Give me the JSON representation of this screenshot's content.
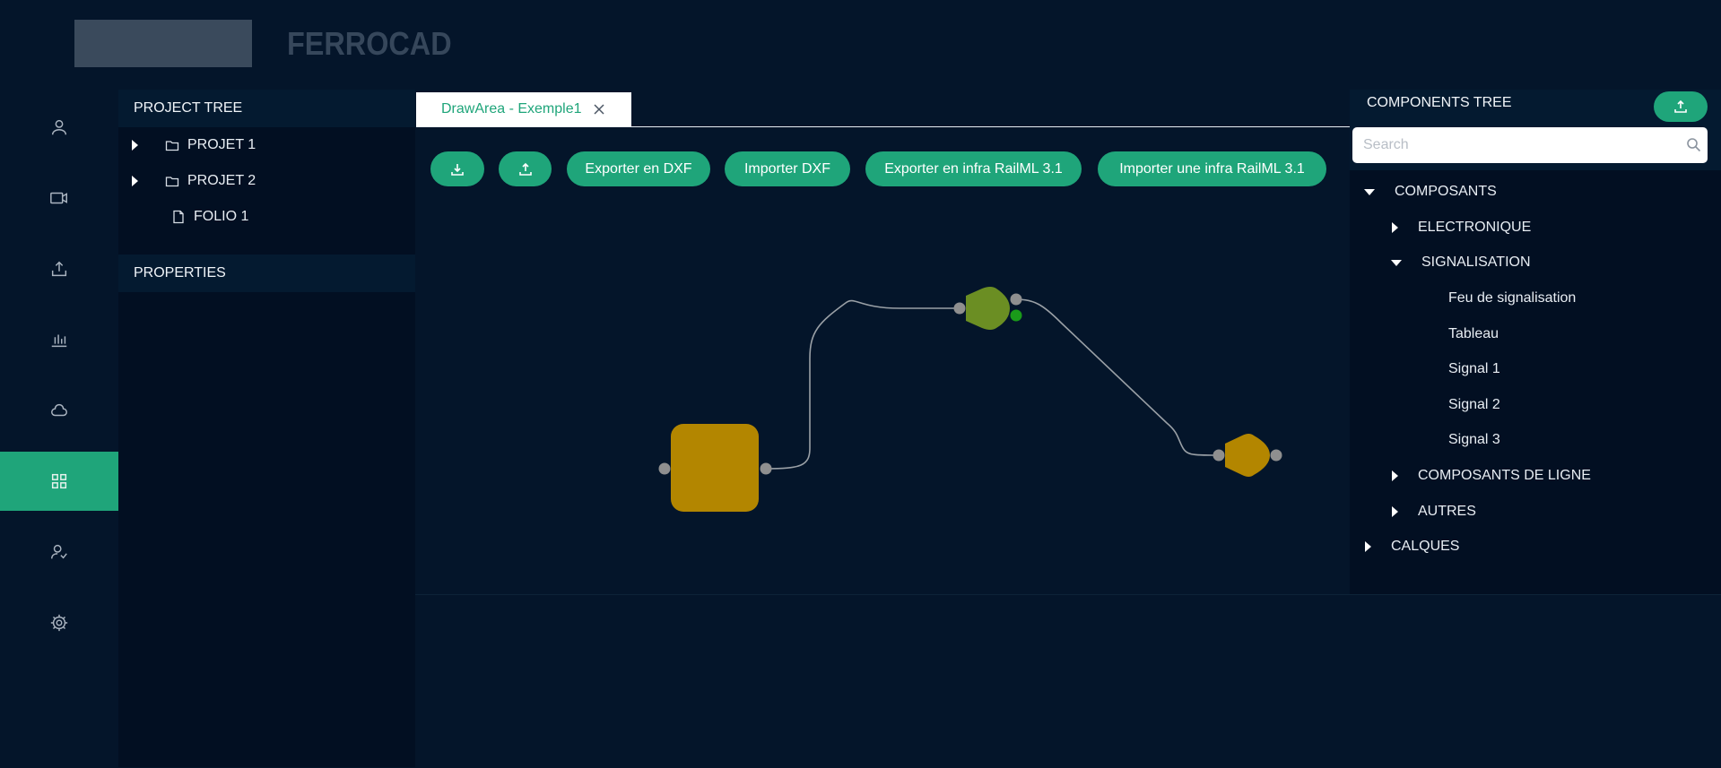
{
  "header": {
    "brand": "FERROCAD"
  },
  "nav": {
    "items": [
      {
        "icon": "user-icon",
        "active": false
      },
      {
        "icon": "video-icon",
        "active": false
      },
      {
        "icon": "upload-icon",
        "active": false
      },
      {
        "icon": "bar-chart-icon",
        "active": false
      },
      {
        "icon": "cloud-icon",
        "active": false
      },
      {
        "icon": "grid-icon",
        "active": true
      },
      {
        "icon": "users-icon",
        "active": false
      },
      {
        "icon": "gear-icon",
        "active": false
      }
    ]
  },
  "project_tree": {
    "title": "PROJECT TREE",
    "items": [
      {
        "label": "PROJET 1",
        "type": "folder",
        "expandable": true
      },
      {
        "label": "PROJET 2",
        "type": "folder",
        "expandable": true
      },
      {
        "label": "FOLIO 1",
        "type": "file",
        "expandable": false
      }
    ],
    "properties_title": "PROPERTIES"
  },
  "draw_area": {
    "tab_label": "DrawArea - Exemple1",
    "toolbar": {
      "export_dxf": "Exporter en DXF",
      "import_dxf": "Importer DXF",
      "export_railml": "Exporter en infra RailML 3.1",
      "import_railml": "Importer une infra RailML 3.1"
    }
  },
  "components_tree": {
    "title": "COMPONENTS TREE",
    "search_placeholder": "Search",
    "items": {
      "composants": "COMPOSANTS",
      "electronique": "ELECTRONIQUE",
      "signalisation": "SIGNALISATION",
      "feu": "Feu de signalisation",
      "tableau": "Tableau",
      "signal1": "Signal 1",
      "signal2": "Signal 2",
      "signal3": "Signal 3",
      "composants_ligne": "COMPOSANTS DE LIGNE",
      "autres": "AUTRES",
      "calques": "CALQUES"
    }
  },
  "colors": {
    "accent": "#1fa57a",
    "background": "#04152a",
    "block_gold": "#b38600",
    "gate_green": "#6b8e23",
    "gate_gold": "#b38600",
    "port_grey": "#8f8f8f",
    "port_green": "#1a9a1a"
  }
}
